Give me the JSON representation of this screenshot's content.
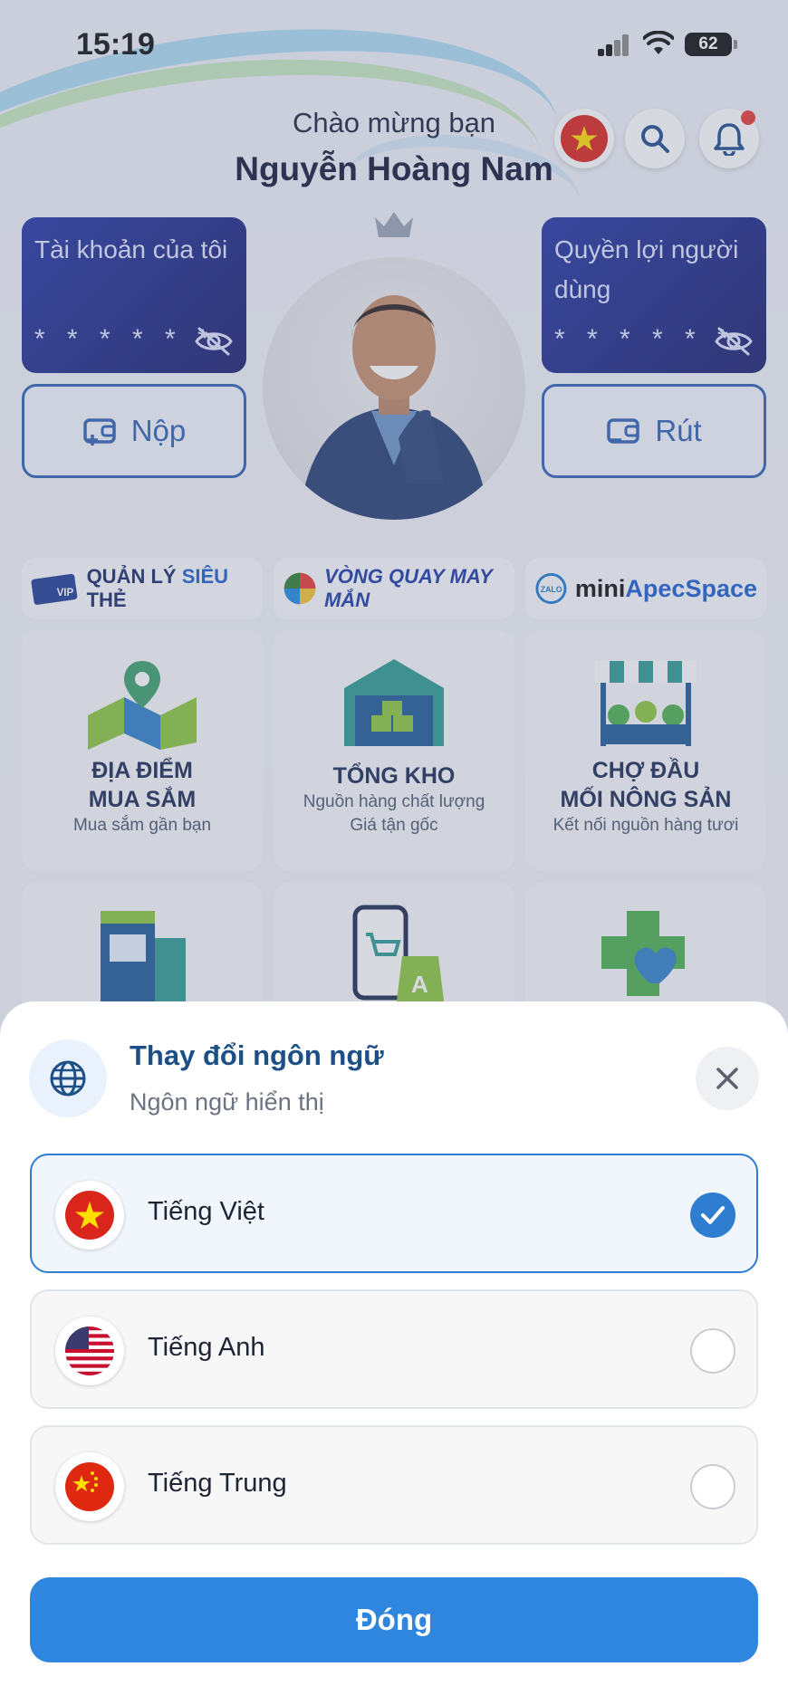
{
  "status_bar": {
    "time": "15:19",
    "battery": "62"
  },
  "header": {
    "welcome": "Chào mừng bạn",
    "user_name": "Nguyễn Hoàng Nam"
  },
  "cards": {
    "account": {
      "title": "Tài khoản của tôi",
      "masked": "* * * * * *"
    },
    "benefits": {
      "title": "Quyền lợi người dùng",
      "masked": "* * * * * *"
    }
  },
  "actions": {
    "deposit": "Nộp",
    "withdraw": "Rút"
  },
  "banners": {
    "card_mgmt": {
      "part1": "QUẢN LÝ",
      "part2": "SIÊU",
      "part3": "THẺ",
      "card_text": "VIP"
    },
    "wheel": "VÒNG QUAY MAY MẮN",
    "mini": {
      "zalo": "ZALO",
      "part1": "mini",
      "part2": "Apec",
      "part3": "Space"
    }
  },
  "tiles": [
    {
      "line1": "ĐỊA ĐIỂM",
      "line2": "MUA SẮM",
      "sub": "Mua sắm gần bạn"
    },
    {
      "line1": "TỔNG KHO",
      "sub1": "Nguồn hàng chất lượng",
      "sub2": "Giá tận gốc"
    },
    {
      "line1": "CHỢ ĐẦU",
      "line2": "MỐI NÔNG SẢN",
      "sub": "Kết nối nguồn hàng tươi"
    }
  ],
  "sheet": {
    "title": "Thay đổi ngôn ngữ",
    "subtitle": "Ngôn ngữ hiển thị",
    "languages": [
      {
        "label": "Tiếng Việt",
        "selected": true,
        "flag": "vietnam-flag"
      },
      {
        "label": "Tiếng Anh",
        "selected": false,
        "flag": "usa-flag"
      },
      {
        "label": "Tiếng Trung",
        "selected": false,
        "flag": "china-flag"
      }
    ],
    "close_label": "Đóng"
  },
  "colors": {
    "primary": "#2F86DE",
    "title_blue": "#1C4F86",
    "card_navy": "#1A1F6E"
  }
}
